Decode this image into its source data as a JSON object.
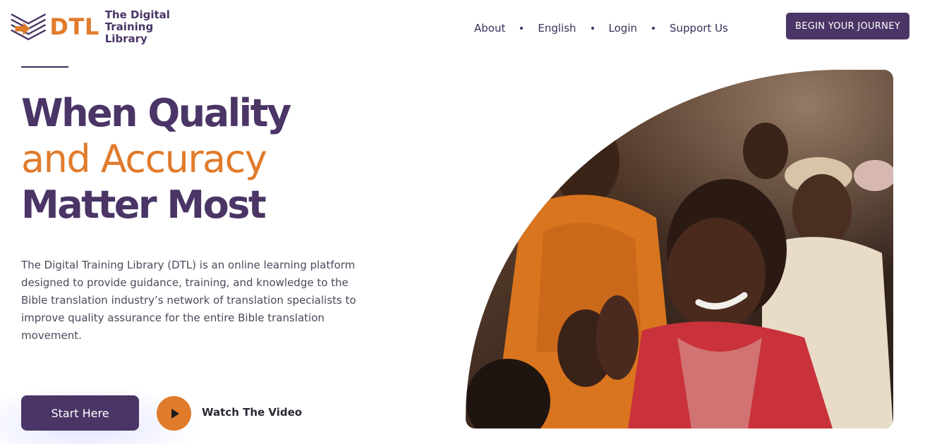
{
  "header": {
    "logo": {
      "abbr": "DTL",
      "name_line1": "The Digital",
      "name_line2": "Training Library"
    },
    "nav": [
      {
        "label": "About"
      },
      {
        "label": "English"
      },
      {
        "label": "Login"
      },
      {
        "label": "Support Us"
      }
    ],
    "cta_label": "BEGIN YOUR JOURNEY"
  },
  "hero": {
    "headline_line1": "When Quality",
    "headline_line2": "and Accuracy",
    "headline_line3": "Matter Most",
    "description": "The Digital Training Library (DTL) is an online learning platform designed to provide guidance, training, and knowledge to the Bible translation industry’s network of translation specialists to improve quality assurance for the entire Bible translation movement.",
    "start_button": "Start Here",
    "video_label": "Watch The Video",
    "icons": {
      "play": "play-icon",
      "logo": "book-arrow-logo-icon"
    },
    "colors": {
      "brand_purple": "#4a3566",
      "brand_orange": "#e07b2c"
    }
  }
}
